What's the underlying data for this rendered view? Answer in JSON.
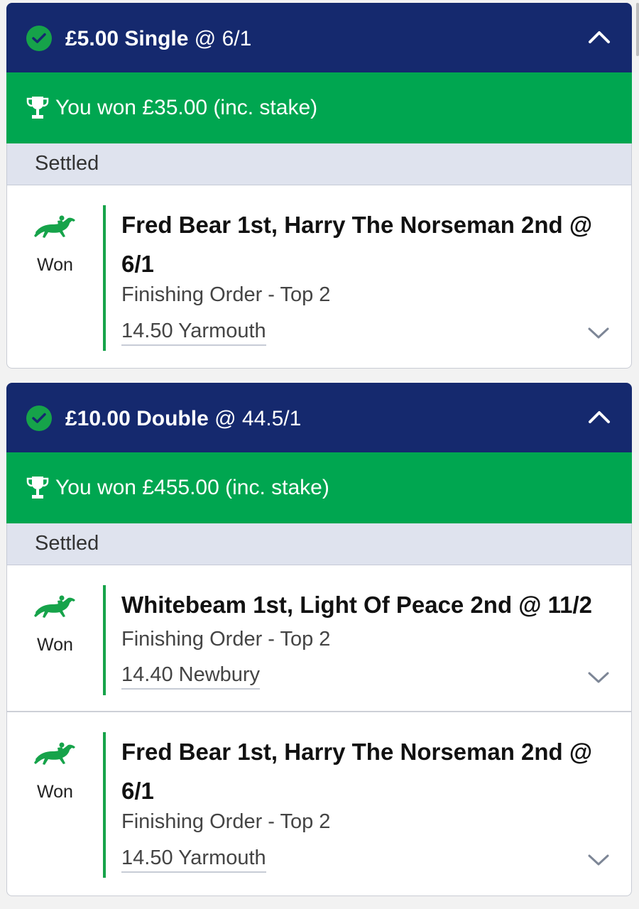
{
  "bets": [
    {
      "stake": "£5.00",
      "bet_type": "Single",
      "odds": "@ 6/1",
      "won_text": "You won £35.00 (inc. stake)",
      "status": "Settled",
      "legs": [
        {
          "result": "Won",
          "selection": "Fred Bear 1st, Harry The Norseman 2nd @ 6/1",
          "market": "Finishing Order - Top 2",
          "event": "14.50 Yarmouth"
        }
      ]
    },
    {
      "stake": "£10.00",
      "bet_type": "Double",
      "odds": "@ 44.5/1",
      "won_text": "You won £455.00 (inc. stake)",
      "status": "Settled",
      "legs": [
        {
          "result": "Won",
          "selection": "Whitebeam 1st, Light Of Peace 2nd @ 11/2",
          "market": "Finishing Order - Top 2",
          "event": "14.40 Newbury"
        },
        {
          "result": "Won",
          "selection": "Fred Bear 1st, Harry The Norseman 2nd @ 6/1",
          "market": "Finishing Order - Top 2",
          "event": "14.50 Yarmouth"
        }
      ]
    }
  ],
  "colors": {
    "header_navy": "#15296e",
    "won_green": "#00a650",
    "status_bg": "#dfe3ee",
    "accent_green": "#16a34a"
  },
  "icons": {
    "check": "check-circle-icon",
    "collapse": "chevron-up-icon",
    "trophy": "trophy-icon",
    "horse": "horse-racing-icon",
    "expand": "chevron-down-icon"
  }
}
